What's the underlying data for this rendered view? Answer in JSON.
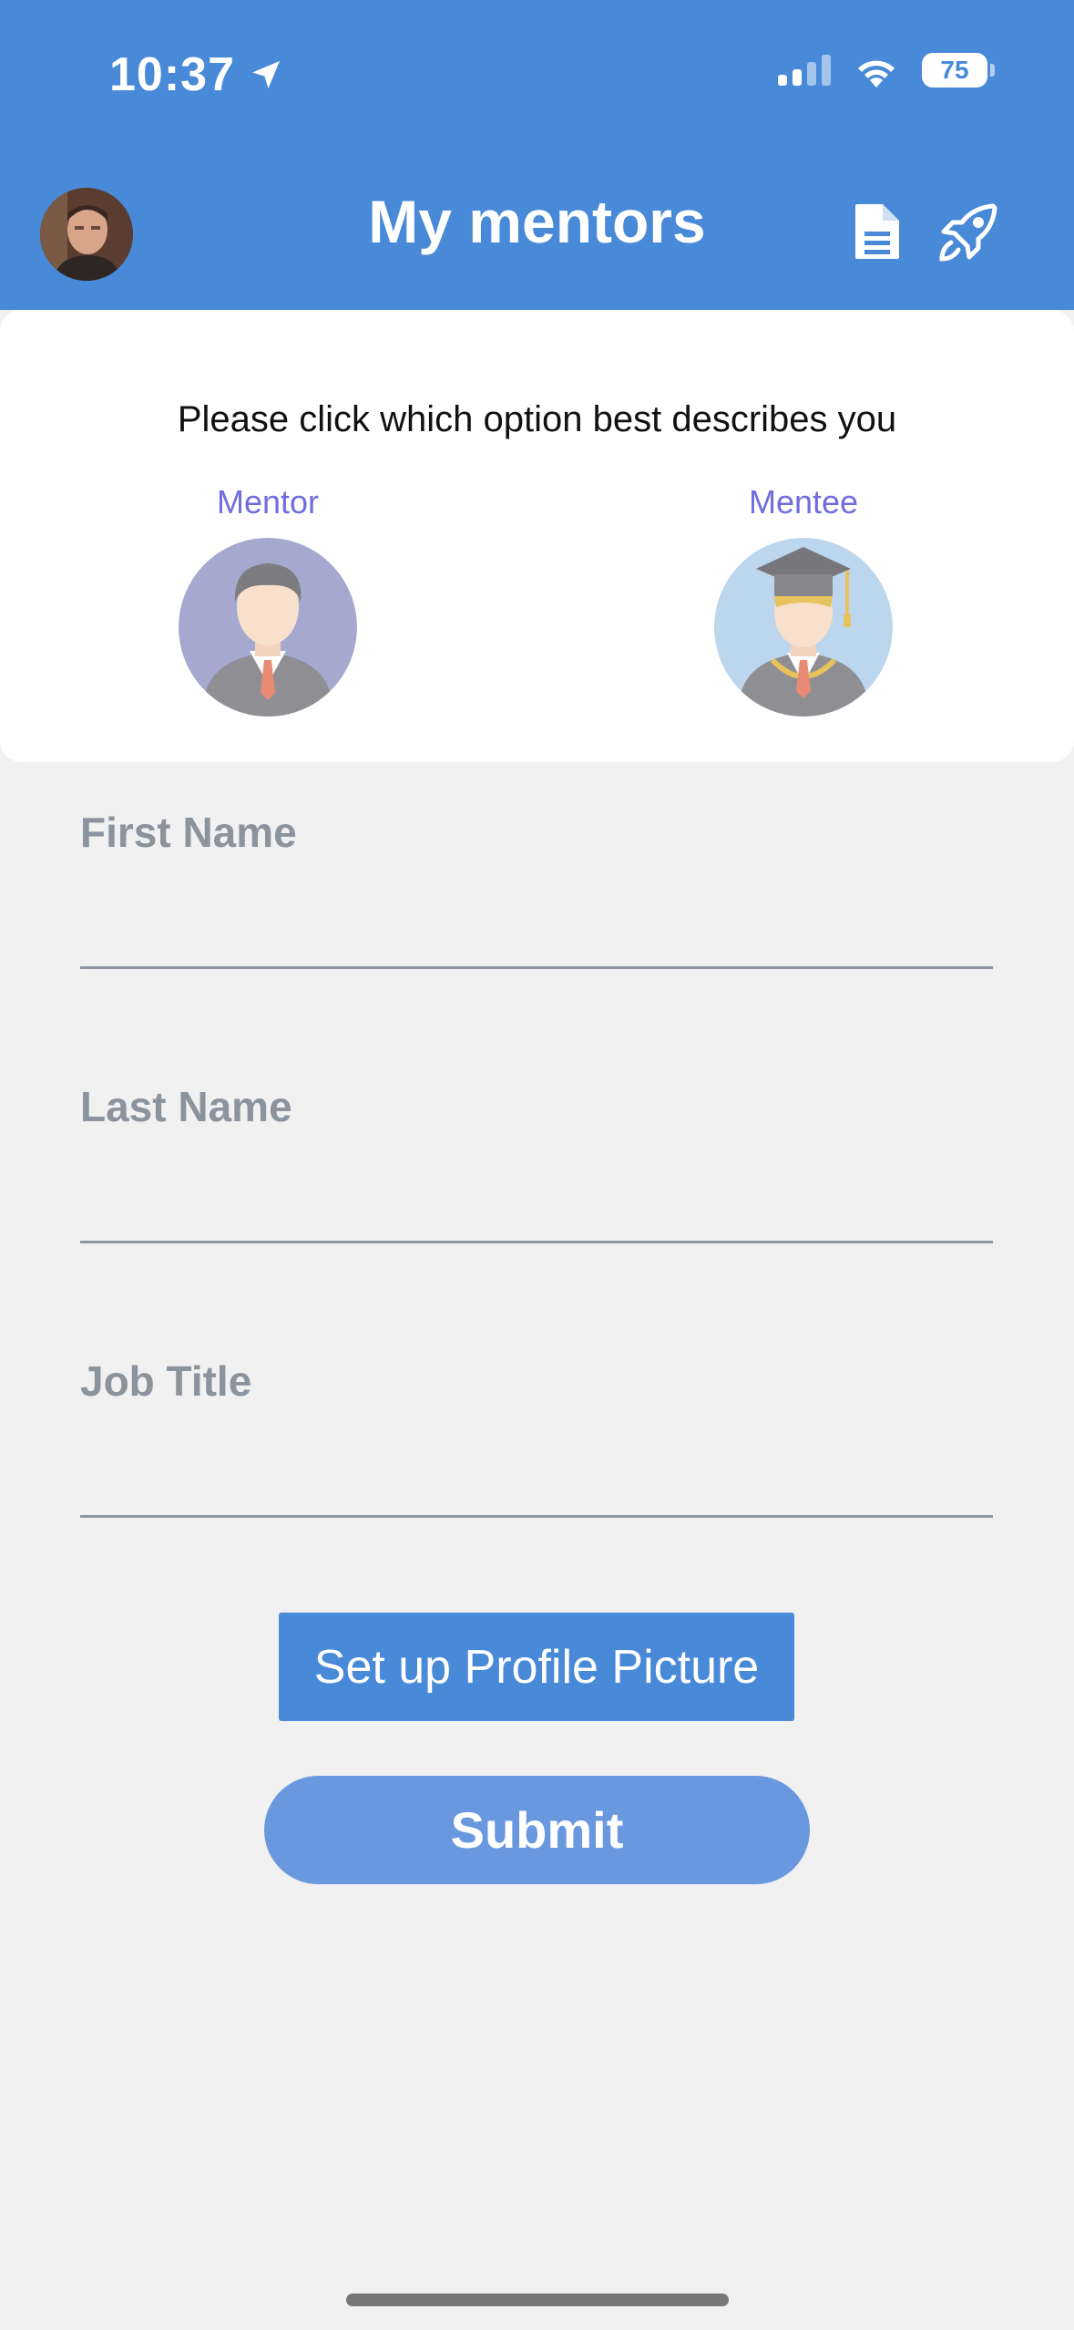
{
  "status_bar": {
    "time": "10:37",
    "battery": "75",
    "location_icon": "location-arrow-icon",
    "signal_icon": "cellular-signal-icon",
    "wifi_icon": "wifi-icon"
  },
  "header": {
    "title": "My mentors",
    "avatar_icon": "user-avatar",
    "actions": [
      "document-icon",
      "rocket-icon"
    ]
  },
  "role_card": {
    "prompt": "Please click which option best describes you",
    "options": [
      {
        "label": "Mentor",
        "icon": "mentor-avatar-icon"
      },
      {
        "label": "Mentee",
        "icon": "mentee-graduate-icon"
      }
    ]
  },
  "form": {
    "fields": [
      {
        "label": "First Name",
        "value": ""
      },
      {
        "label": "Last Name",
        "value": ""
      },
      {
        "label": "Job Title",
        "value": ""
      }
    ],
    "setup_picture_label": "Set up Profile Picture",
    "submit_label": "Submit"
  },
  "colors": {
    "header_bg": "#4889d8",
    "accent_text": "#6f6ee0",
    "submit_bg": "#6a98df",
    "page_bg": "#f1f1f1"
  }
}
